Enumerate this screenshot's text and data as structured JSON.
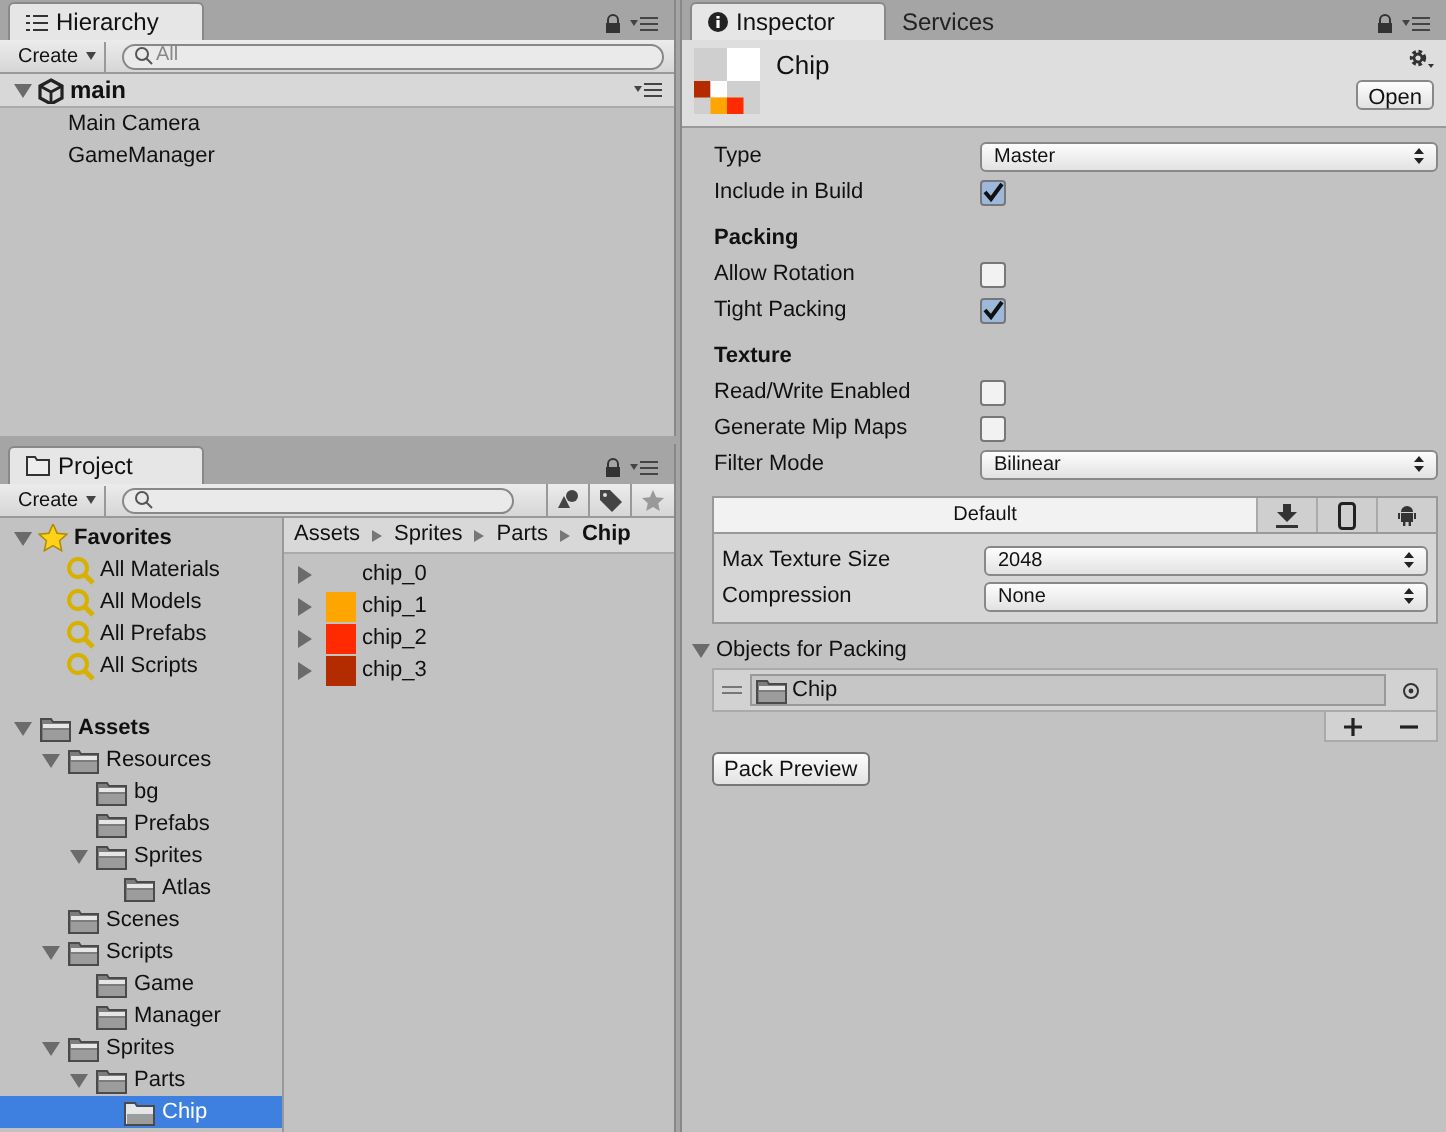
{
  "hierarchy": {
    "tabs": [
      {
        "label": "Hierarchy",
        "selected": true
      }
    ],
    "create": "Create",
    "search_placeholder": "All",
    "scene": {
      "name": "main",
      "expanded": true,
      "items": [
        "Main Camera",
        "GameManager"
      ]
    }
  },
  "project": {
    "tabs": [
      {
        "label": "Project",
        "selected": true
      }
    ],
    "create": "Create",
    "favorites": {
      "label": "Favorites",
      "expanded": true,
      "items": [
        "All Materials",
        "All Models",
        "All Prefabs",
        "All Scripts"
      ]
    },
    "assets": [
      {
        "label": "Assets",
        "expanded": true,
        "selected": false,
        "children": [
          {
            "label": "Resources",
            "expanded": true,
            "selected": false,
            "children": [
              {
                "label": "bg",
                "selected": false
              },
              {
                "label": "Prefabs",
                "selected": false
              },
              {
                "label": "Sprites",
                "expanded": true,
                "selected": false,
                "children": [
                  {
                    "label": "Atlas",
                    "selected": false
                  }
                ]
              }
            ]
          },
          {
            "label": "Scenes",
            "selected": false
          },
          {
            "label": "Scripts",
            "expanded": true,
            "selected": false,
            "children": [
              {
                "label": "Game",
                "selected": false
              },
              {
                "label": "Manager",
                "selected": false
              }
            ]
          },
          {
            "label": "Sprites",
            "expanded": true,
            "selected": false,
            "children": [
              {
                "label": "Parts",
                "expanded": true,
                "selected": false,
                "children": [
                  {
                    "label": "Chip",
                    "selected": true
                  }
                ]
              }
            ]
          }
        ]
      }
    ],
    "breadcrumb": [
      "Assets",
      "Sprites",
      "Parts",
      "Chip"
    ],
    "files": [
      {
        "name": "chip_0"
      },
      {
        "name": "chip_1",
        "color": "#ffa500"
      },
      {
        "name": "chip_2",
        "color": "#ff2a00"
      },
      {
        "name": "chip_3",
        "color": "#b22c00"
      }
    ]
  },
  "inspector": {
    "tabs": [
      {
        "label": "Inspector",
        "selected": true
      },
      {
        "label": "Services",
        "selected": false
      }
    ],
    "title": "Chip",
    "open_button": "Open",
    "fields": [
      {
        "kind": "select",
        "label": "Type",
        "value": "Master"
      },
      {
        "kind": "checkbox",
        "label": "Include in Build",
        "checked": true
      },
      {
        "kind": "heading",
        "label": "Packing"
      },
      {
        "kind": "checkbox",
        "label": "Allow Rotation",
        "checked": false
      },
      {
        "kind": "checkbox",
        "label": "Tight Packing",
        "checked": true
      },
      {
        "kind": "heading",
        "label": "Texture"
      },
      {
        "kind": "checkbox",
        "label": "Read/Write Enabled",
        "checked": false
      },
      {
        "kind": "checkbox",
        "label": "Generate Mip Maps",
        "checked": false
      },
      {
        "kind": "select",
        "label": "Filter Mode",
        "value": "Bilinear"
      }
    ],
    "platforms": {
      "tabs": [
        {
          "kind": "text",
          "label": "Default",
          "selected": true
        },
        {
          "kind": "download",
          "selected": false
        },
        {
          "kind": "phone",
          "selected": false
        },
        {
          "kind": "android",
          "selected": false
        }
      ],
      "fields": [
        {
          "label": "Max Texture Size",
          "value": "2048"
        },
        {
          "label": "Compression",
          "value": "None"
        }
      ]
    },
    "objects": {
      "label": "Objects for Packing",
      "expanded": true,
      "items": [
        "Chip"
      ]
    },
    "pack_button": "Pack Preview"
  }
}
